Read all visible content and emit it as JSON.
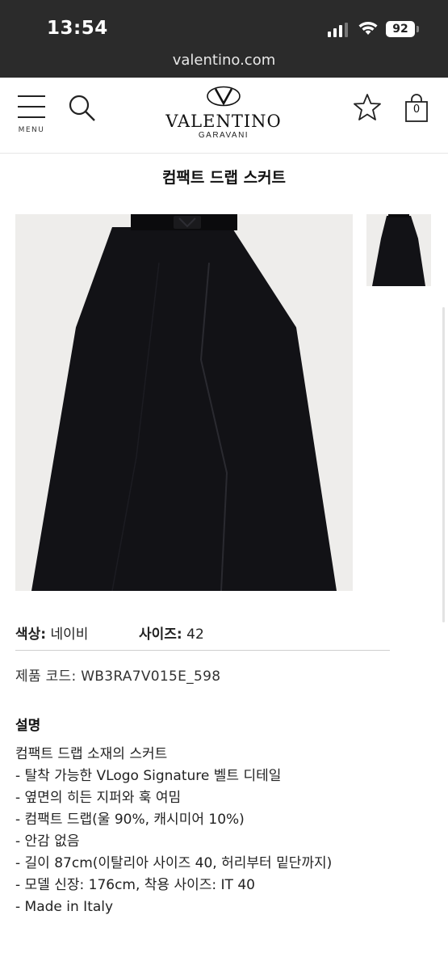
{
  "status_bar": {
    "time": "13:54",
    "battery": "92"
  },
  "url_bar": {
    "url": "valentino.com"
  },
  "header": {
    "menu_label": "MENU",
    "logo_brand": "VALENTINO",
    "logo_sub": "GARAVANI",
    "cart_count": "0"
  },
  "product": {
    "title": "컴팩트 드랩 스커트",
    "color_label": "색상:",
    "color_value": "네이비",
    "size_label": "사이즈:",
    "size_value": "42",
    "code_text": "제품 코드: WB3RA7V015E_598",
    "description_title": "설명",
    "description_lines": [
      "컴팩트 드랩 소재의 스커트",
      "- 탈착 가능한 VLogo Signature 벨트 디테일",
      "- 옆면의 히든 지퍼와 훅 여밈",
      "- 컴팩트 드랩(울 90%, 캐시미어 10%)",
      "- 안감 없음",
      "- 길이 87cm(이탈리아 사이즈 40, 허리부터 밑단까지)",
      "- 모델 신장: 176cm, 착용 사이즈: IT 40",
      "- Made in Italy"
    ]
  },
  "colors": {
    "status_bg": "#2b2b2b",
    "image_bg": "#eeedeb",
    "skirt": "#121216"
  }
}
